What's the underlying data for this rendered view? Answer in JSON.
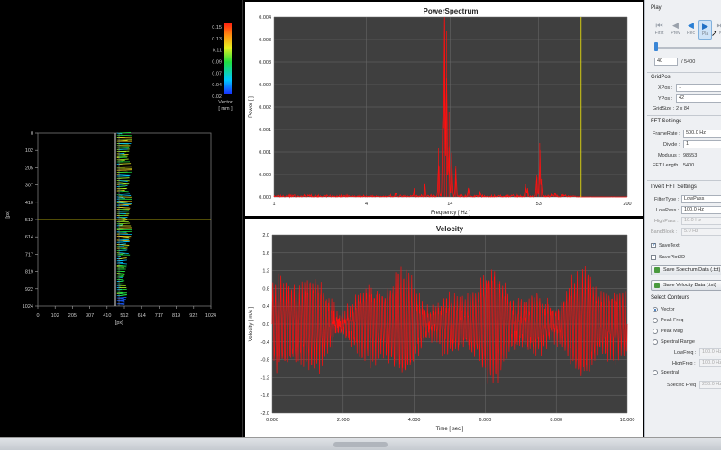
{
  "colors": {
    "plot_bg": "#3f3f3f",
    "grid": "#6d6d6d",
    "trace": "#ff1010",
    "cursor_line": "#d4cc12",
    "panel_bg": "#eef0f3",
    "accent": "#2a7fd4"
  },
  "vector_panel": {
    "colorbar": {
      "ticks": [
        "0.15",
        "0.13",
        "0.11",
        "0.09",
        "0.07",
        "0.04",
        "0.02"
      ],
      "unit_label": "Vector",
      "unit": "[ mm ]"
    },
    "x_ticks": [
      "0",
      "102",
      "205",
      "307",
      "410",
      "512",
      "614",
      "717",
      "819",
      "922",
      "1024"
    ],
    "y_ticks": [
      "0",
      "102",
      "205",
      "307",
      "410",
      "512",
      "614",
      "717",
      "819",
      "922",
      "1024"
    ],
    "x_unit": "[px]",
    "y_unit": "[px]",
    "cursor_y": 512,
    "cursor_x": 480
  },
  "chart_data": [
    {
      "type": "line",
      "title": "PowerSpectrum",
      "xlabel": "Frequency [ Hz ]",
      "ylabel": "Power [ ]",
      "x_scale": "log",
      "xlim": [
        1,
        200
      ],
      "ylim": [
        0,
        0.004
      ],
      "x_ticks": [
        "1",
        "4",
        "14",
        "53",
        "200"
      ],
      "y_ticks": [
        "0.000",
        "0.000",
        "0.001",
        "0.001",
        "0.002",
        "0.002",
        "0.003",
        "0.003",
        "0.004"
      ],
      "cursor_x_hz": 100,
      "peaks": [
        {
          "x": 12.9,
          "y": 0.004
        },
        {
          "x": 13.3,
          "y": 0.0037
        },
        {
          "x": 12.6,
          "y": 0.0024
        },
        {
          "x": 13.8,
          "y": 0.0019
        },
        {
          "x": 14.4,
          "y": 0.0012
        },
        {
          "x": 11.8,
          "y": 0.0011
        },
        {
          "x": 15.3,
          "y": 0.0007
        },
        {
          "x": 9.6,
          "y": 0.0003
        },
        {
          "x": 8.2,
          "y": 0.0002
        },
        {
          "x": 6.2,
          "y": 0.0001
        },
        {
          "x": 18.5,
          "y": 0.0002
        },
        {
          "x": 22.0,
          "y": 0.00012
        },
        {
          "x": 43.5,
          "y": 0.0003
        },
        {
          "x": 44.8,
          "y": 0.0002
        },
        {
          "x": 51.5,
          "y": 0.0005
        },
        {
          "x": 53.8,
          "y": 0.0012
        },
        {
          "x": 55.2,
          "y": 0.0004
        },
        {
          "x": 68.0,
          "y": 0.0001
        }
      ]
    },
    {
      "type": "line",
      "title": "Velocity",
      "xlabel": "Time [ sec ]",
      "ylabel": "Velocity [ m/s ]",
      "xlim": [
        0,
        10
      ],
      "ylim": [
        -2.0,
        2.0
      ],
      "x_ticks": [
        "0.000",
        "2.000",
        "4.000",
        "6.000",
        "8.000",
        "10.000"
      ],
      "y_ticks": [
        "2.0",
        "1.6",
        "1.2",
        "0.8",
        "0.4",
        "0.0",
        "-0.4",
        "-0.8",
        "-1.2",
        "-1.6",
        "-2.0"
      ],
      "signal": {
        "carrier_hz": 13.3,
        "mean_amplitude": 0.85,
        "peak_amplitude": 1.6
      }
    }
  ],
  "controls": {
    "play_title": "Play",
    "buttons": [
      {
        "id": "first",
        "label": "First",
        "icon": "skip-back-icon"
      },
      {
        "id": "prev",
        "label": "Prev",
        "icon": "step-back-icon"
      },
      {
        "id": "rec",
        "label": "Rec",
        "icon": "play-reverse-icon"
      },
      {
        "id": "play",
        "label": "Pla",
        "icon": "play-icon"
      },
      {
        "id": "next",
        "label": "N",
        "icon": "skip-forward-icon"
      }
    ],
    "frame_value": "40",
    "frame_total": "/ 5400",
    "gridpos": {
      "title": "GridPos",
      "xpos_label": "XPos :",
      "xpos": "1",
      "ypos_label": "YPos :",
      "ypos": "42",
      "gridsize_label": "GridSize :",
      "gridsize": "2 x 84"
    },
    "fft": {
      "title": "FFT Settings",
      "framerate_label": "FrameRate :",
      "framerate": "500.0 Hz",
      "divide_label": "Divide :",
      "divide": "1",
      "modulus_label": "Modulus :",
      "modulus": "98553",
      "length_label": "FFT Length :",
      "length": "5400"
    },
    "ifft": {
      "title": "Invert FFT Settings",
      "filtertype_label": "FilterType :",
      "filtertype": "LowPass",
      "lowpass_label": "LowPass :",
      "lowpass": "100.0 Hz",
      "highpass_label": "HighPass :",
      "highpass": "10.0 Hz",
      "bandblock_label": "BandBlock :",
      "bandblock": "5.0 Hz"
    },
    "savetext_label": "SaveText",
    "saveplot3d_label": "SavePlot3D",
    "save_spectrum_label": "Save Spectrum Data (.txt)",
    "save_velocity_label": "Save Velocity Data (.txt)",
    "contours": {
      "title": "Select Contours",
      "options": [
        "Vector",
        "Peak Freq",
        "Peak Mag",
        "Spectral Range",
        "Spectral"
      ],
      "selected": "Vector",
      "lowfreq_label": "LowFreq :",
      "lowfreq": "100.0 Hz",
      "highfreq_label": "HighFreq :",
      "highfreq": "100.0 Hz",
      "specific_label": "Specific Freq :",
      "specific": "250.0 Hz"
    }
  }
}
